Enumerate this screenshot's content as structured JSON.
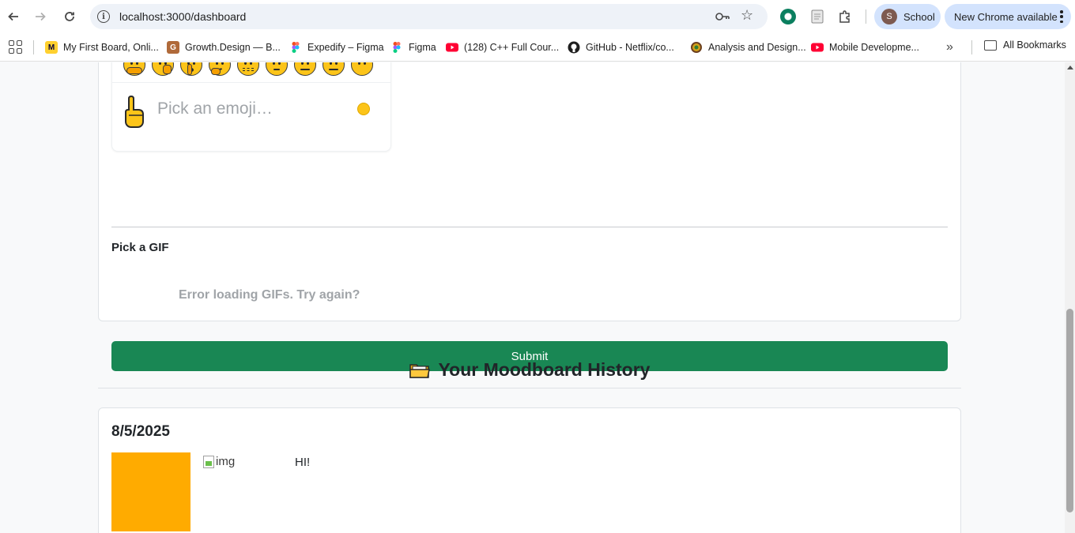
{
  "browser": {
    "url": "localhost:3000/dashboard",
    "profile_initial": "S",
    "profile_name": "School",
    "update_label": "New Chrome available"
  },
  "bookmarks": [
    {
      "label": "My First Board, Onli...",
      "icon": "miro-icon",
      "color": "#ffd02f"
    },
    {
      "label": "Growth.Design — B...",
      "icon": "growth-design-icon",
      "color": "#b06a3a"
    },
    {
      "label": "Expedify – Figma",
      "icon": "figma-icon",
      "color": "#f24e1e"
    },
    {
      "label": "Figma",
      "icon": "figma-icon",
      "color": "#a259ff"
    },
    {
      "label": "(128) C++ Full Cour...",
      "icon": "youtube-icon",
      "color": "#ff0033"
    },
    {
      "label": "GitHub - Netflix/co...",
      "icon": "github-icon",
      "color": "#1f1f1f"
    },
    {
      "label": "Analysis and Design...",
      "icon": "site-icon",
      "color": "#8a6d3b"
    },
    {
      "label": "Mobile Developme...",
      "icon": "youtube-icon",
      "color": "#ff0033"
    }
  ],
  "all_bookmarks_label": "All Bookmarks",
  "form": {
    "emoji_search_placeholder": "Pick an emoji…",
    "gif_label": "Pick a GIF",
    "gif_error": "Error loading GIFs. Try again?",
    "submit_label": "Submit"
  },
  "history": {
    "title": "Your Moodboard History",
    "entries": [
      {
        "date": "8/5/2025",
        "color": "#ffab00",
        "img_alt": "img",
        "text": "HI!"
      }
    ]
  }
}
